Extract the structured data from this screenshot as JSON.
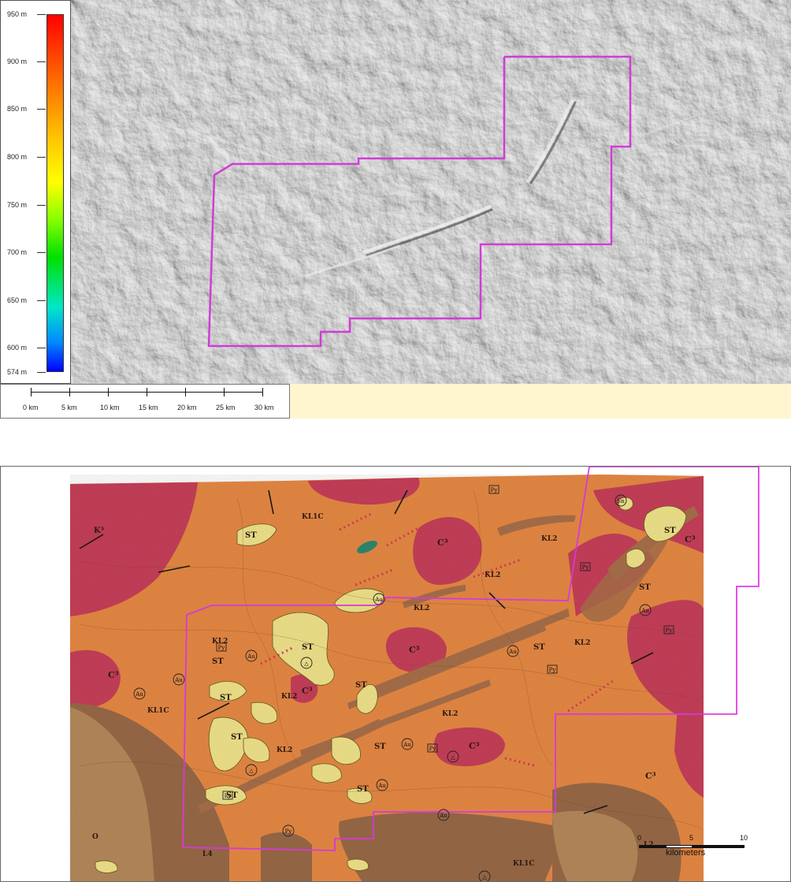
{
  "top_map": {
    "elevation_legend": {
      "labels": [
        "950 m",
        "900 m",
        "850 m",
        "800 m",
        "750 m",
        "700 m",
        "650 m",
        "600 m",
        "574 m"
      ],
      "ramp_colors": [
        "#ff0000",
        "#ff6a00",
        "#ffcc00",
        "#ffff00",
        "#8cff00",
        "#00e000",
        "#00e6c8",
        "#0088ff",
        "#0000ff"
      ]
    },
    "scale_bar": {
      "labels": [
        "0 km",
        "5 km",
        "10 km",
        "15 km",
        "20 km",
        "25 km",
        "30 km"
      ]
    },
    "boundary_color": "#d13cd6",
    "hillshade_color": "#8a8a8a"
  },
  "bottom_map": {
    "unit_labels": {
      "klic": "KL1C",
      "kl2": "KL2",
      "st": "ST",
      "c3": "C³",
      "l4": "L4",
      "l2": "L2",
      "o": "O",
      "k3": "K³"
    },
    "symbols": {
      "au": "Au",
      "py": "Py",
      "sn": "Sn",
      "delta": "△"
    },
    "scale_bar": {
      "labels": [
        "0",
        "5",
        "10"
      ],
      "unit": "kilometers"
    },
    "colors": {
      "orange": "#e88a45",
      "magenta": "#c8405a",
      "brown": "#9a6a48",
      "tan": "#b78a5c",
      "yellow": "#f2e58c",
      "boundary": "#e23ce6"
    }
  }
}
